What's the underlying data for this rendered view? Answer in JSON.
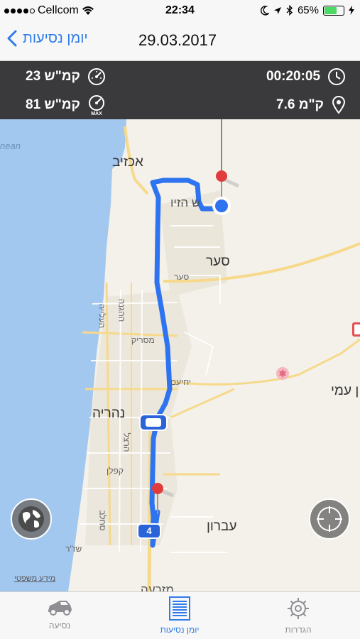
{
  "status_bar": {
    "carrier": "Cellcom",
    "time": "22:34",
    "battery": "65%",
    "battery_level": 0.65
  },
  "nav": {
    "back_label": "יומן נסיעות",
    "title": "29.03.2017"
  },
  "stats": {
    "duration": "00:20:05",
    "distance": "7.6 ק\"מ",
    "avg_speed": "23 קמ\"ש",
    "max_speed": "81 קמ\"ש"
  },
  "map": {
    "ocean_label": "nean",
    "labels": {
      "achziv": "אכזיב",
      "ziv": "ש הזיו",
      "saar_big": "סער",
      "saar_small": "סער",
      "haaliya": "העלייה",
      "hahagana": "ההגנה",
      "mesarik": "מסריק",
      "yehiam": "יחיעם",
      "nahariya": "נהריה",
      "herzl": "הרצל",
      "kaplan": "קפלן",
      "evron": "עברון",
      "amy": "ן עמי",
      "shahar": "שז\"ר",
      "sachlav": "סחלב",
      "mazraa": "מזרעה",
      "route": "4"
    },
    "legal": "מידע משפטי",
    "colors": {
      "route": "#2e74f0",
      "water": "#a3c8f0",
      "land": "#f4f1ea",
      "road": "#f6d98a",
      "pin": "#e23b3b"
    }
  },
  "tabs": [
    {
      "label": "נסיעה",
      "icon": "car-icon",
      "active": false
    },
    {
      "label": "יומן נסיעות",
      "icon": "list-icon",
      "active": true
    },
    {
      "label": "הגדרות",
      "icon": "gear-icon",
      "active": false
    }
  ]
}
